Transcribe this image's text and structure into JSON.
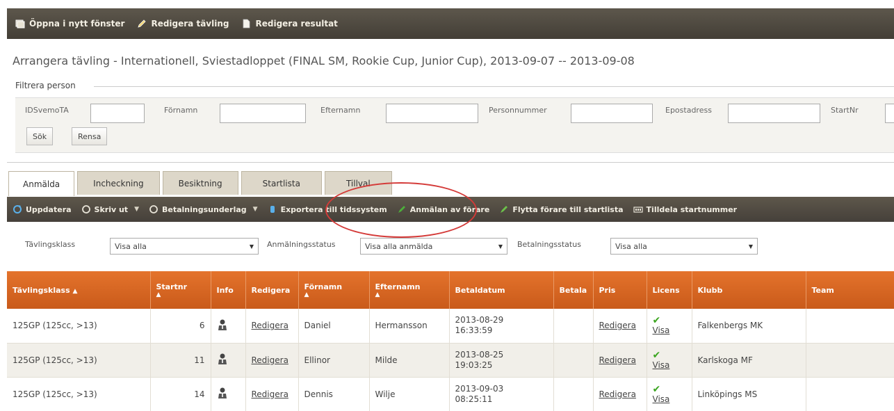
{
  "topbar": {
    "items": [
      {
        "label": "Öppna i nytt fönster",
        "icon": "window-icon"
      },
      {
        "label": "Redigera tävling",
        "icon": "pencil-icon"
      },
      {
        "label": "Redigera resultat",
        "icon": "document-icon"
      }
    ]
  },
  "page_title": "Arrangera tävling - Internationell, Sviestadloppet (FINAL SM, Rookie Cup, Junior Cup), 2013-09-07 -- 2013-09-08",
  "filter": {
    "legend": "Filtrera person",
    "fields": {
      "idsvemota": "IDSvemoTA",
      "fornamn": "Förnamn",
      "efternamn": "Efternamn",
      "personnummer": "Personnummer",
      "epostadress": "Epostadress",
      "startnr": "StartNr"
    },
    "sok_label": "Sök",
    "rensa_label": "Rensa"
  },
  "tabs": [
    {
      "label": "Anmälda",
      "active": true
    },
    {
      "label": "Incheckning",
      "active": false
    },
    {
      "label": "Besiktning",
      "active": false
    },
    {
      "label": "Startlista",
      "active": false
    },
    {
      "label": "Tillval",
      "active": false
    }
  ],
  "toolbar": {
    "uppdatera": "Uppdatera",
    "skriv_ut": "Skriv ut",
    "betalningsunderlag": "Betalningsunderlag",
    "exportera": "Exportera till tidssystem",
    "anmalan": "Anmälan av förare",
    "flytta": "Flytta förare till startlista",
    "tilldela": "Tilldela startnummer"
  },
  "selectors": {
    "tavlingsklass_label": "Tävlingsklass",
    "tavlingsklass_value": "Visa alla",
    "anmalningsstatus_label": "Anmälningsstatus",
    "anmalningsstatus_value": "Visa alla anmälda",
    "betalningsstatus_label": "Betalningsstatus",
    "betalningsstatus_value": "Visa alla"
  },
  "table": {
    "headers": {
      "tavlingsklass": "Tävlingsklass",
      "startnr": "Startnr",
      "info": "Info",
      "redigera": "Redigera",
      "fornamn": "Förnamn",
      "efternamn": "Efternamn",
      "betaldatum": "Betaldatum",
      "betala": "Betala",
      "pris": "Pris",
      "licens": "Licens",
      "klubb": "Klubb",
      "team": "Team"
    },
    "sort_asc": "▲",
    "rows": [
      {
        "klass": "125GP (125cc, >13)",
        "startnr": "6",
        "redigera": "Redigera",
        "fornamn": "Daniel",
        "efternamn": "Hermansson",
        "date": "2013-08-29",
        "time": "16:33:59",
        "betala": "",
        "pris": "Redigera",
        "licens": "Visa",
        "klubb": "Falkenbergs MK",
        "team": ""
      },
      {
        "klass": "125GP (125cc, >13)",
        "startnr": "11",
        "redigera": "Redigera",
        "fornamn": "Ellinor",
        "efternamn": "Milde",
        "date": "2013-08-25",
        "time": "19:03:25",
        "betala": "",
        "pris": "Redigera",
        "licens": "Visa",
        "klubb": "Karlskoga MF",
        "team": ""
      },
      {
        "klass": "125GP (125cc, >13)",
        "startnr": "14",
        "redigera": "Redigera",
        "fornamn": "Dennis",
        "efternamn": "Wilje",
        "date": "2013-09-03",
        "time": "08:25:11",
        "betala": "",
        "pris": "Redigera",
        "licens": "Visa",
        "klubb": "Linköpings MS",
        "team": ""
      }
    ]
  },
  "colors": {
    "header_bar": "#4e483f",
    "table_header": "#d9662a",
    "annotation": "#d43a38",
    "check": "#3aa51f"
  }
}
